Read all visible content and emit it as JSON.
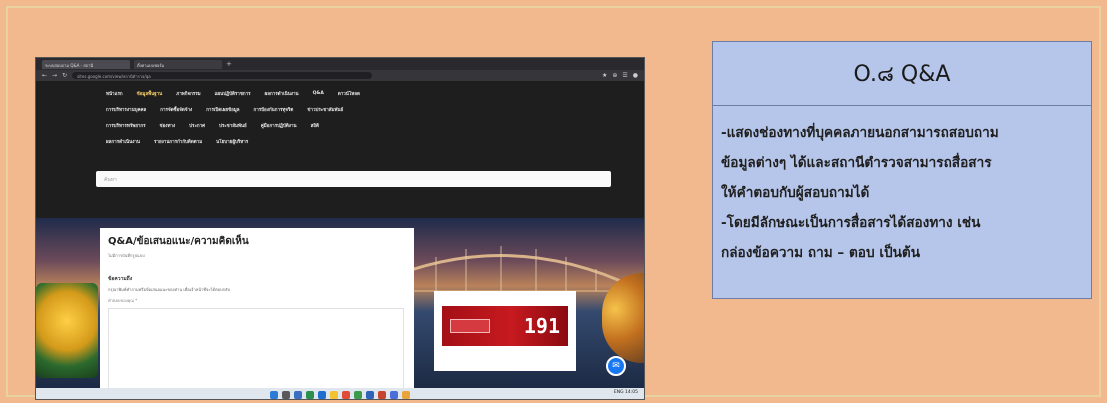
{
  "browser": {
    "tabs": [
      "ระบบสอบถาม Q&A - สถานี",
      "ตั้งค่าแบบฟอร์ม"
    ],
    "new_tab": "+",
    "url": "sites.google.com/view/สถานีตำรวจ/qa",
    "nav_icons": [
      "back-arrow",
      "forward-arrow",
      "reload"
    ],
    "addr_icons": [
      "★",
      "⊕",
      "☰",
      "●"
    ]
  },
  "site_menu": {
    "rows": [
      [
        "หน้าแรก",
        "ข้อมูลพื้นฐาน",
        "ภาพกิจกรรม",
        "แผนปฏิบัติราชการ",
        "ผลการดำเนินงาน",
        "Q&A",
        "ดาวน์โหลด"
      ],
      [
        "การบริหารงานบุคคล",
        "การจัดซื้อจัดจ้าง",
        "การเปิดเผยข้อมูล",
        "การป้องกันการทุจริต",
        "ข่าวประชาสัมพันธ์"
      ],
      [
        "การบริหารทรัพยากร",
        "ช่องทาง",
        "ประกาศ",
        "ประชาสัมพันธ์",
        "คู่มือการปฏิบัติงาน",
        "สถิติ"
      ],
      [
        "ผลการดำเนินงาน",
        "รายงานการกำกับติดตาม",
        "นโยบายผู้บริหาร"
      ]
    ],
    "search_placeholder": "ค้นหา"
  },
  "form": {
    "title": "Q&A/ข้อเสนอแนะ/ความคิดเห็น",
    "subtitle": "ไม่มีการบันทึกรูปแบบ",
    "field_label": "ข้อความถึง",
    "field_description": "กรุณาพิมพ์คำถามหรือข้อเสนอแนะของท่าน เพื่อเจ้าหน้าที่จะได้ตอบกลับ",
    "required_note": "คำตอบของคุณ *"
  },
  "banner": {
    "hotline": "191"
  },
  "taskbar": {
    "tray_text": "ENG 14:05"
  },
  "panel": {
    "title": "O.๘ Q&A",
    "lines": [
      "-แสดงช่องทางที่บุคคลภายนอกสามารถสอบถาม",
      "ข้อมูลต่างๆ ได้และสถานีตำรวจสามารถสื่อสาร",
      "ให้คำตอบกับผู้สอบถามได้",
      "-โดยมีลักษณะเป็นการสื่อสารได้สองทาง เช่น",
      "กล่องข้อความ ถาม – ตอบ เป็นต้น"
    ]
  },
  "colors": {
    "slide_bg": "#f2b98f",
    "panel_bg": "#b6c6ea",
    "panel_border": "#6d7ea6",
    "hotline_red": "#c61a1f",
    "messenger_blue": "#1877f2"
  }
}
